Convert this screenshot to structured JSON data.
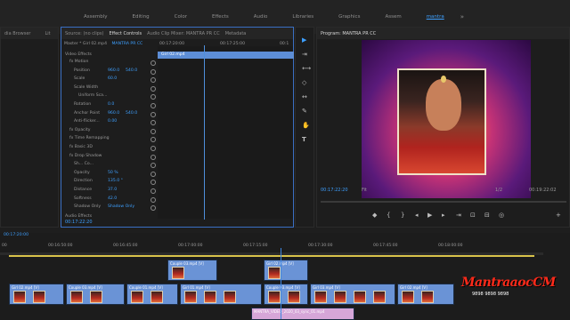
{
  "workspaces": [
    "Assembly",
    "Editing",
    "Color",
    "Effects",
    "Audio",
    "Libraries",
    "Graphics",
    "Assem",
    "mantra"
  ],
  "active_workspace": "mantra",
  "left_edge_panel": {
    "label": "dia Browser",
    "extra": "Lit"
  },
  "effect_controls": {
    "tabs": [
      "Source: (no clips)",
      "Effect Controls",
      "Audio Clip Mixer: MANTRA PR CC",
      "Metadata"
    ],
    "active_tab": "Effect Controls",
    "master_label": "Master * Girl 02.mp4",
    "sequence_label": "MANTRA PR CC",
    "timecode_start": "00:17:20:00",
    "timecode_mid": "00:17:25:00",
    "timecode_end": "00:1",
    "clip_name": "Girl 02.mp4",
    "section_video": "Video Effects",
    "rows": [
      {
        "label": "Motion",
        "value": "",
        "indent": 1
      },
      {
        "label": "Position",
        "value": "960.0",
        "value2": "540.0",
        "indent": 2
      },
      {
        "label": "Scale",
        "value": "60.0",
        "indent": 2
      },
      {
        "label": "Scale Width",
        "value": "",
        "indent": 2
      },
      {
        "label": "Uniform Sca...",
        "value": "",
        "indent": 3
      },
      {
        "label": "Rotation",
        "value": "0.0",
        "indent": 2
      },
      {
        "label": "Anchor Point",
        "value": "960.0",
        "value2": "540.0",
        "indent": 2
      },
      {
        "label": "Anti-flicker...",
        "value": "0.00",
        "indent": 2
      },
      {
        "label": "Opacity",
        "value": "",
        "indent": 1
      },
      {
        "label": "Time Remapping",
        "value": "",
        "indent": 1
      },
      {
        "label": "Basic 3D",
        "value": "",
        "indent": 1
      },
      {
        "label": "Drop Shadow",
        "value": "",
        "indent": 1
      },
      {
        "label": "Sh... Co...",
        "value": "",
        "indent": 2
      },
      {
        "label": "Opacity",
        "value": "50 %",
        "indent": 2
      },
      {
        "label": "Direction",
        "value": "135.0 °",
        "indent": 2
      },
      {
        "label": "Distance",
        "value": "37.0",
        "indent": 2
      },
      {
        "label": "Softness",
        "value": "42.0",
        "indent": 2
      },
      {
        "label": "Shadow Only",
        "value": "Shadow Only",
        "indent": 2
      }
    ],
    "section_audio": "Audio Effects",
    "footer_timecode": "00:17:22:20"
  },
  "program_monitor": {
    "title": "Program: MANTRA PR CC",
    "timecode_left": "00:17:22:20",
    "fit": "Fit",
    "scale": "1/2",
    "timecode_right": "00:19:22:02"
  },
  "timeline": {
    "header_timecode": "00:17:20:00",
    "ruler": [
      "00:16:50:00",
      "00:16:45:00",
      "00:17:00:00",
      "00:17:15:00",
      "00:17:30:00",
      "00:17:45:00",
      "00:18:00:00"
    ],
    "ruler_left": "00",
    "clips_top": [
      {
        "label": "Couple 03.mp4 [V]"
      },
      {
        "label": "Girl 02.mp4 [V]"
      }
    ],
    "clips_bottom": [
      {
        "label": "Girl 02.mp4 [V]"
      },
      {
        "label": "Couple 03.mp4 [V]"
      },
      {
        "label": "Couple 01.mp4 [V]"
      },
      {
        "label": "Girl 01.mp4 [V]"
      },
      {
        "label": "Couple 03.mp4 [V]"
      },
      {
        "label": "Girl 03.mp4 [V]"
      },
      {
        "label": "Girl 02.mp4 [V]"
      }
    ],
    "audio_clip": "MANTRA_VIDEO_2020_03_sync_01.mp4"
  },
  "watermark": {
    "brand": "MantraaocCM",
    "sub": "9898 9898 9898"
  }
}
